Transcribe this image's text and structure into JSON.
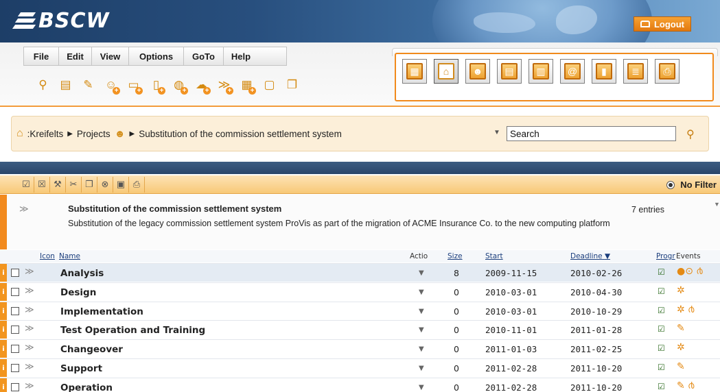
{
  "app": {
    "logo": "BSCW",
    "logout_label": "Logout"
  },
  "menu": [
    "File",
    "Edit",
    "View",
    "Options",
    "GoTo",
    "Help"
  ],
  "toolbar_icons": [
    "open-icon",
    "rename-icon",
    "edit-icon",
    "add-member-icon",
    "add-folder-icon",
    "add-document-icon",
    "add-url-icon",
    "add-discussion-icon",
    "add-project-icon",
    "add-note-icon",
    "forward-icon",
    "copy-icon"
  ],
  "panel_icons": [
    "clipboard-icon",
    "home-icon",
    "community-icon",
    "calendar-icon",
    "bag-icon",
    "address-icon",
    "task-icon",
    "bookmark-icon",
    "print-icon"
  ],
  "breadcrumb": {
    "root": ":Kreifelts",
    "projects": "Projects",
    "current": "Substitution of the commission settlement system"
  },
  "search": {
    "value": "Search"
  },
  "filter": {
    "label": "No Filter"
  },
  "folder": {
    "title": "Substitution of the commission settlement system",
    "description": "Substitution of the legacy commission settlement system ProVis as part of the migration of ACME Insurance Co. to the new computing platform",
    "entries": "7 entries"
  },
  "columns": {
    "icon": "Icon",
    "name": "Name",
    "action": "Actio",
    "size": "Size",
    "start": "Start",
    "deadline": "Deadline",
    "progress": "Progr",
    "events": "Events"
  },
  "rows": [
    {
      "name": "Analysis",
      "size": "8",
      "start": "2009-11-15",
      "deadline": "2010-02-26",
      "events": "●⊙ ൪"
    },
    {
      "name": "Design",
      "size": "0",
      "start": "2010-03-01",
      "deadline": "2010-04-30",
      "events": "✲"
    },
    {
      "name": "Implementation",
      "size": "0",
      "start": "2010-03-01",
      "deadline": "2010-10-29",
      "events": "✲ ൪"
    },
    {
      "name": "Test Operation and Training",
      "size": "0",
      "start": "2010-11-01",
      "deadline": "2011-01-28",
      "events": "✎"
    },
    {
      "name": "Changeover",
      "size": "0",
      "start": "2011-01-03",
      "deadline": "2011-02-25",
      "events": "✲"
    },
    {
      "name": "Support",
      "size": "0",
      "start": "2011-02-28",
      "deadline": "2011-10-20",
      "events": "✎"
    },
    {
      "name": "Operation",
      "size": "0",
      "start": "2011-02-28",
      "deadline": "2011-10-20",
      "events": "✎ ൪"
    }
  ]
}
